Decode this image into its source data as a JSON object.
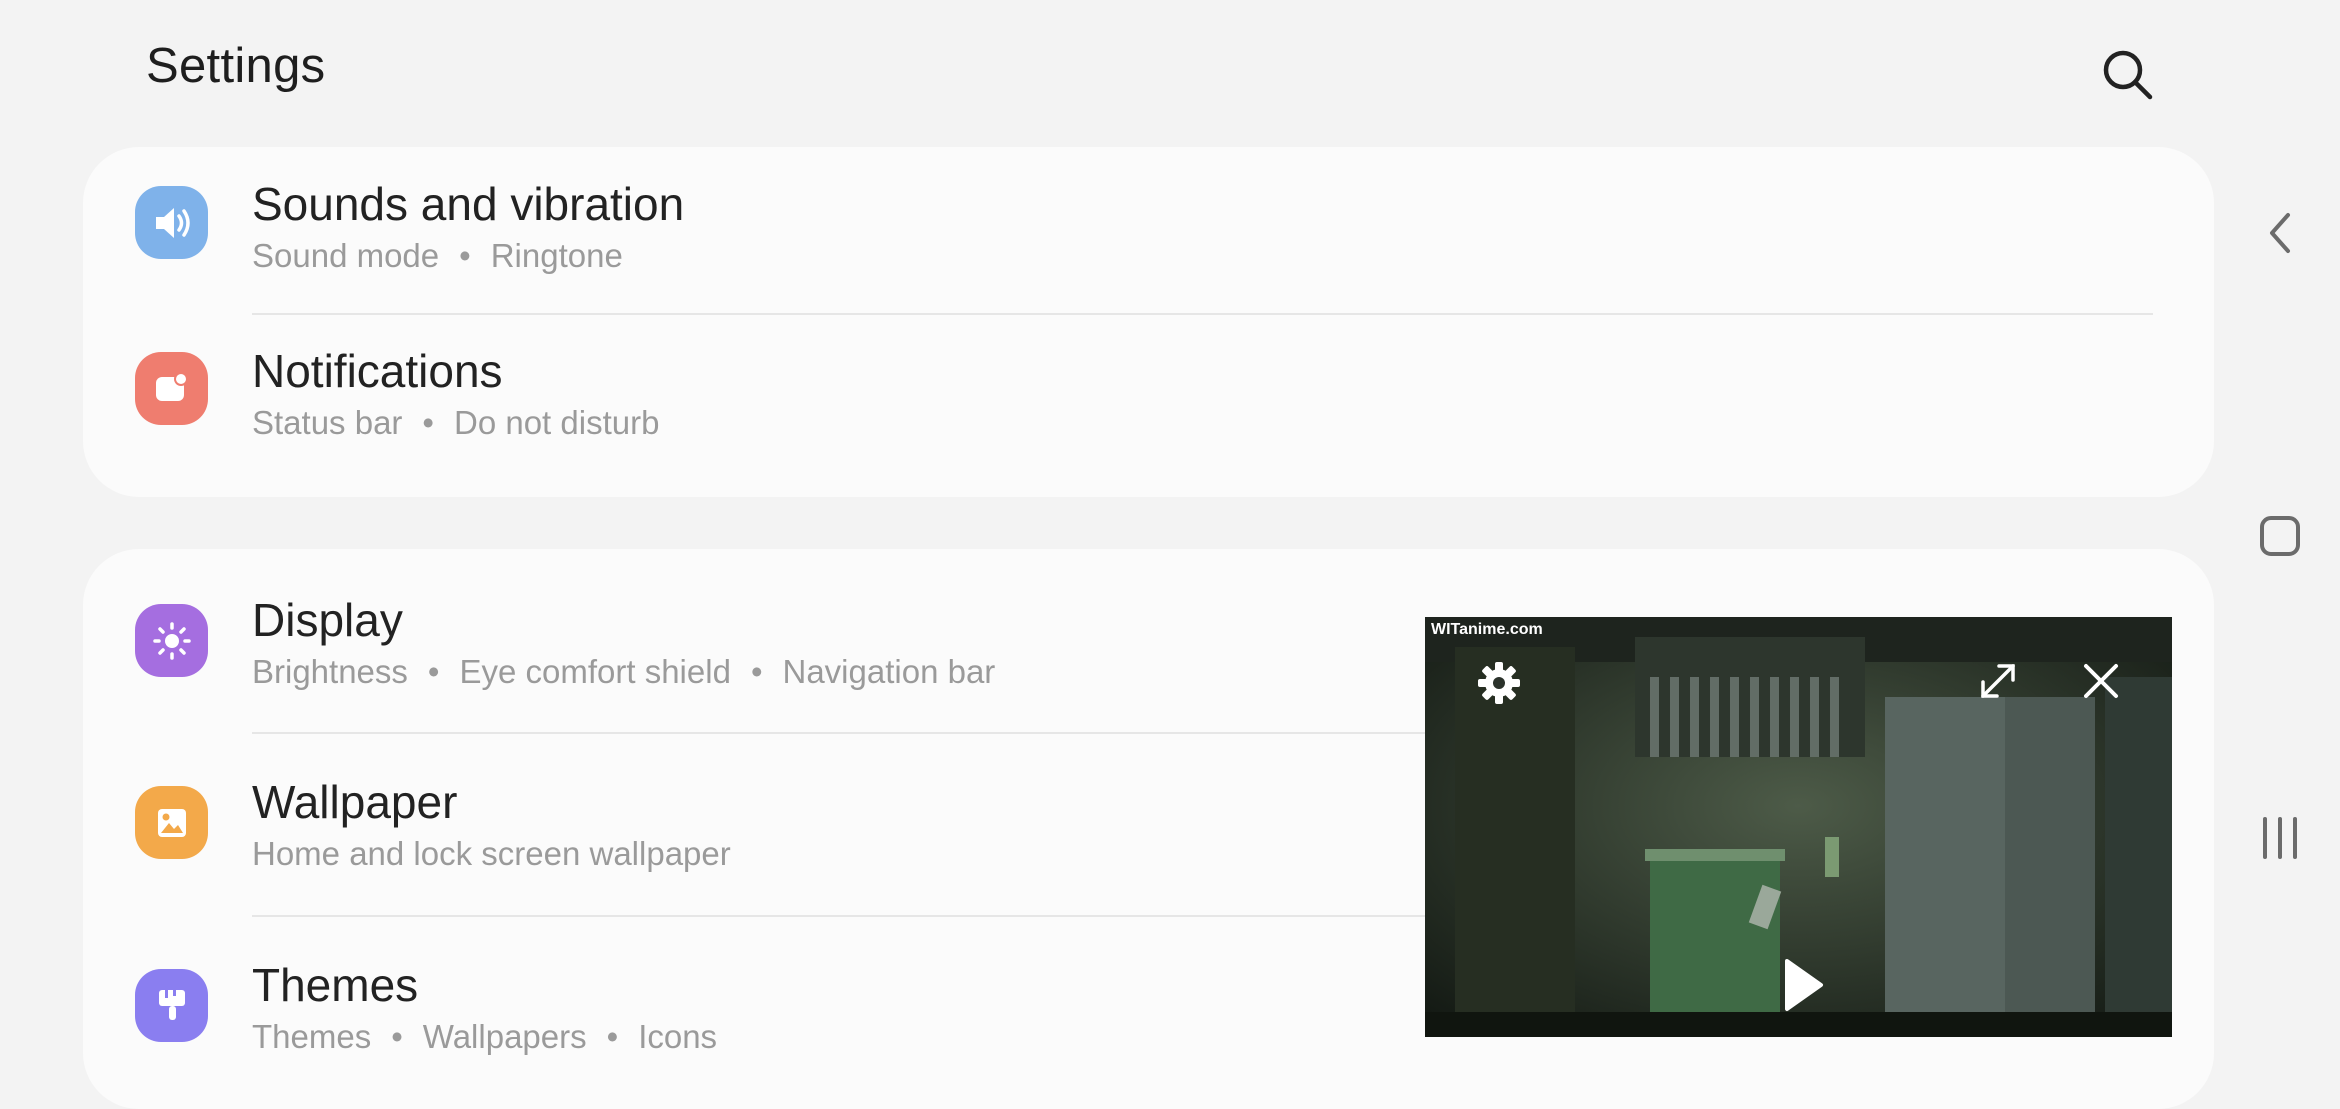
{
  "header": {
    "title": "Settings"
  },
  "groups": [
    {
      "items": [
        {
          "title": "Sounds and vibration",
          "subtitle": [
            "Sound mode",
            "Ringtone"
          ],
          "icon": "speaker-icon",
          "color": "#7fb2ea"
        },
        {
          "title": "Notifications",
          "subtitle": [
            "Status bar",
            "Do not disturb"
          ],
          "icon": "notification-icon",
          "color": "#ef7d6f"
        }
      ]
    },
    {
      "items": [
        {
          "title": "Display",
          "subtitle": [
            "Brightness",
            "Eye comfort shield",
            "Navigation bar"
          ],
          "icon": "sun-icon",
          "color": "#a56ee0"
        },
        {
          "title": "Wallpaper",
          "subtitle": [
            "Home and lock screen wallpaper"
          ],
          "icon": "picture-icon",
          "color": "#f3a94a"
        },
        {
          "title": "Themes",
          "subtitle": [
            "Themes",
            "Wallpapers",
            "Icons"
          ],
          "icon": "brush-icon",
          "color": "#8a7ef0"
        }
      ]
    }
  ],
  "pip": {
    "watermark": "WITanime.com"
  },
  "icons": {
    "search": "search-icon",
    "back": "chevron-left-icon",
    "home": "home-square-icon",
    "recents": "recents-bars-icon",
    "pip_settings": "gear-icon",
    "pip_expand": "expand-icon",
    "pip_close": "close-icon",
    "pip_play": "play-icon"
  }
}
